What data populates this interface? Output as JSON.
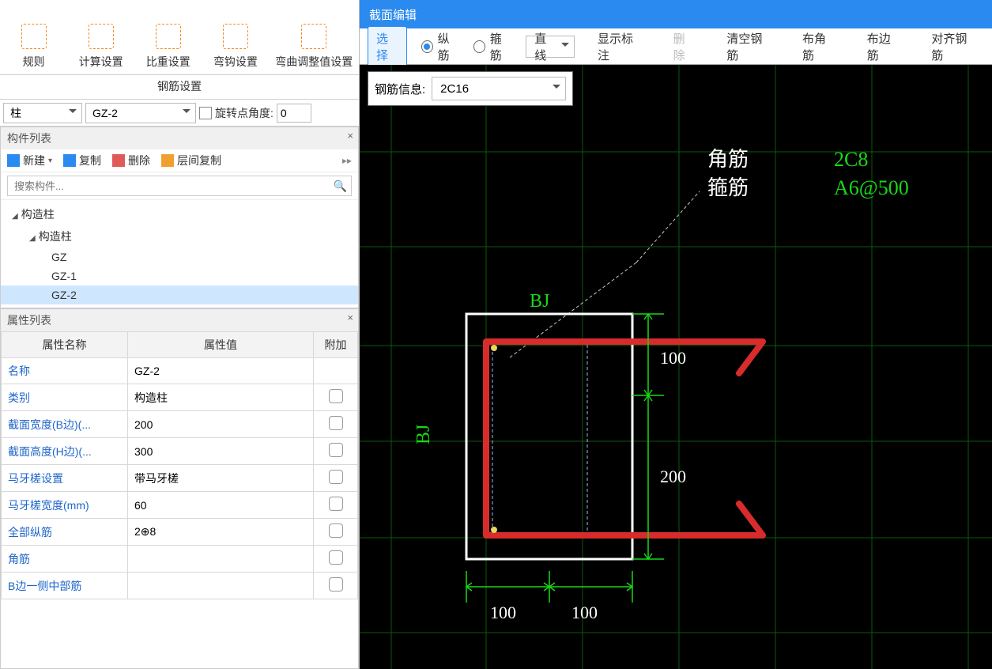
{
  "ribbon": {
    "items": [
      "规则",
      "计算设置",
      "比重设置",
      "弯钩设置",
      "弯曲调整值设置"
    ],
    "group_label": "钢筋设置"
  },
  "dropdown_bar": {
    "combo1": "柱",
    "combo2": "GZ-2",
    "rotate_label": "旋转点角度:",
    "rotate_value": "0"
  },
  "component_panel": {
    "title": "构件列表",
    "toolbar": {
      "new": "新建",
      "copy": "复制",
      "delete": "删除",
      "floor_copy": "层间复制"
    },
    "search_placeholder": "搜索构件...",
    "tree": {
      "root": "构造柱",
      "sub": "构造柱",
      "items": [
        "GZ",
        "GZ-1",
        "GZ-2"
      ],
      "selected": "GZ-2"
    }
  },
  "property_panel": {
    "title": "属性列表",
    "headers": [
      "属性名称",
      "属性值",
      "附加"
    ],
    "rows": [
      {
        "name": "名称",
        "value": "GZ-2",
        "chk": false
      },
      {
        "name": "类别",
        "value": "构造柱",
        "chk": true
      },
      {
        "name": "截面宽度(B边)(...",
        "value": "200",
        "chk": true
      },
      {
        "name": "截面高度(H边)(...",
        "value": "300",
        "chk": true
      },
      {
        "name": "马牙槎设置",
        "value": "带马牙槎",
        "chk": true
      },
      {
        "name": "马牙槎宽度(mm)",
        "value": "60",
        "chk": true
      },
      {
        "name": "全部纵筋",
        "value": "2⊕8",
        "chk": true
      },
      {
        "name": "角筋",
        "value": "",
        "chk": true
      },
      {
        "name": "B边一侧中部筋",
        "value": "",
        "chk": true
      }
    ]
  },
  "section_editor": {
    "title": "截面编辑",
    "toolbar": {
      "select": "选择",
      "long_bar": "纵筋",
      "stirrup": "箍筋",
      "line": "直线",
      "show_dim": "显示标注",
      "delete": "删除",
      "clear": "清空钢筋",
      "corner": "布角筋",
      "edge": "布边筋",
      "align": "对齐钢筋",
      "radio_selected": "long_bar"
    },
    "rebar_info": {
      "label": "钢筋信息:",
      "value": "2C16"
    },
    "canvas": {
      "bj_top": "BJ",
      "bj_left": "BJ",
      "dims": {
        "v1": "100",
        "v2": "200",
        "h1": "100",
        "h2": "100"
      },
      "legend": {
        "row1_cn": "角筋",
        "row1_val": "2C8",
        "row2_cn": "箍筋",
        "row2_val": "A6@500"
      }
    }
  }
}
